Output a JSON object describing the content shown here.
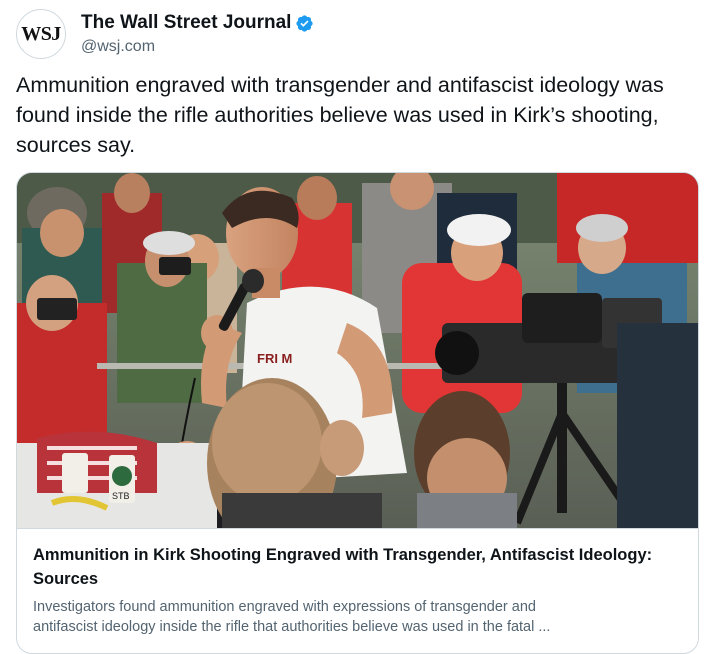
{
  "author": {
    "display_name": "The Wall Street Journal",
    "handle": "@wsj.com",
    "avatar_text": "WSJ",
    "verified_icon": "verified-badge-icon",
    "verified_color": "#1d9bf0"
  },
  "tweet": {
    "text": "Ammunition engraved with transgender and antifascist ideology was found inside the rifle authorities believe was used in Kirk’s shooting, sources say."
  },
  "link_card": {
    "image_mug_text": "STB",
    "image_shirt_text": "FRI M",
    "title": "Ammunition in Kirk Shooting Engraved with Transgender, Antifascist Ideology: Sources",
    "description_line1": "Investigators found ammunition engraved with expressions of transgender and",
    "description_line2": "antifascist ideology inside the rifle that authorities believe was used in the fatal ..."
  },
  "colors": {
    "text_primary": "#0f1419",
    "text_secondary": "#536471",
    "border": "#cfd9de"
  }
}
